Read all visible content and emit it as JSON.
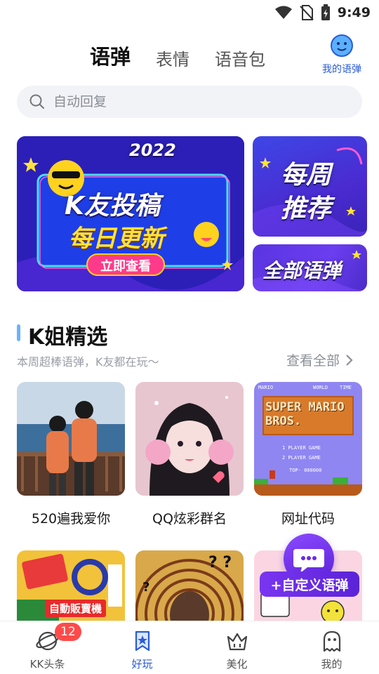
{
  "status": {
    "time": "9:49"
  },
  "tabs": [
    {
      "label": "语弹"
    },
    {
      "label": "表情"
    },
    {
      "label": "语音包"
    }
  ],
  "my_voice": {
    "label": "我的语弹"
  },
  "search": {
    "placeholder": "自动回复"
  },
  "banners": {
    "main": {
      "year": "2022",
      "line1": "K友投稿",
      "line2": "每日更新",
      "cta": "立即查看"
    },
    "side1": {
      "line1": "每周",
      "line2": "推荐"
    },
    "side2": {
      "text": "全部语弹"
    }
  },
  "section": {
    "title": "K姐精选",
    "subtitle": "本周超棒语弹，K友都在玩～",
    "view_all": "查看全部"
  },
  "cards": [
    {
      "label": "520遍我爱你"
    },
    {
      "label": "QQ炫彩群名"
    },
    {
      "label": "网址代码",
      "image_text": "SUPER MARIO BROS."
    }
  ],
  "cards_row2_text": {
    "vending": "自動販賣機"
  },
  "fab": {
    "label": "+自定义语弹"
  },
  "bottom_nav": [
    {
      "label": "KK头条",
      "badge": "12"
    },
    {
      "label": "好玩"
    },
    {
      "label": "美化"
    },
    {
      "label": "我的"
    }
  ],
  "colors": {
    "accent": "#2a5bd7",
    "badge": "#ff4a4a",
    "highlight": "#ffd21e"
  }
}
